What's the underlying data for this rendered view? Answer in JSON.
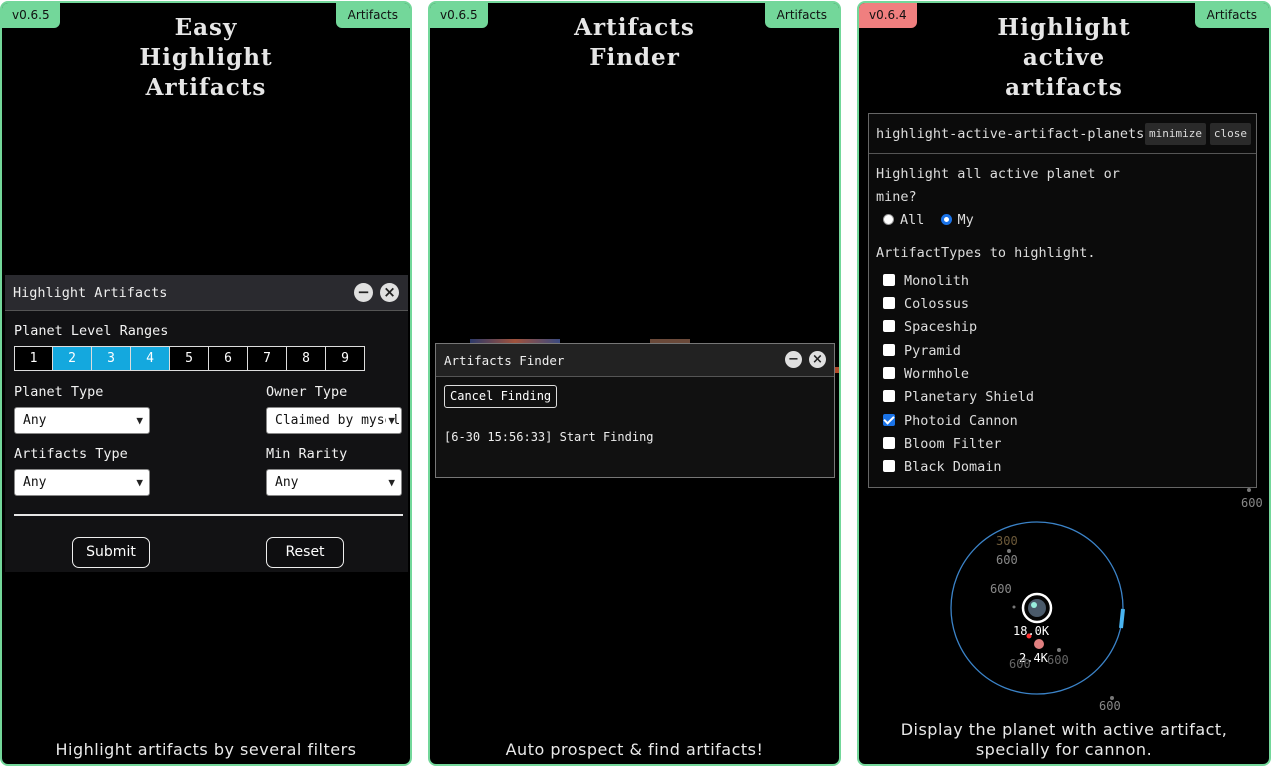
{
  "cards": [
    {
      "version": "v0.6.5",
      "tag": "Artifacts",
      "title_lines": [
        "Easy",
        "Highlight",
        "Artifacts"
      ],
      "caption": "Highlight artifacts by several filters",
      "panel": {
        "title": "Highlight Artifacts",
        "level_label": "Planet Level Ranges",
        "levels": [
          "1",
          "2",
          "3",
          "4",
          "5",
          "6",
          "7",
          "8",
          "9"
        ],
        "selected_levels": [
          "2",
          "3",
          "4"
        ],
        "planet_type_label": "Planet Type",
        "planet_type_value": "Any",
        "owner_type_label": "Owner Type",
        "owner_type_value": "Claimed by myself",
        "artifacts_type_label": "Artifacts Type",
        "artifacts_type_value": "Any",
        "min_rarity_label": "Min Rarity",
        "min_rarity_value": "Any",
        "submit_label": "Submit",
        "reset_label": "Reset"
      }
    },
    {
      "version": "v0.6.5",
      "tag": "Artifacts",
      "title_lines": [
        "Artifacts",
        "Finder"
      ],
      "caption": "Auto prospect & find artifacts!",
      "panel": {
        "title": "Artifacts Finder",
        "cancel_label": "Cancel Finding",
        "log_line": "[6-30 15:56:33] Start Finding"
      }
    },
    {
      "version": "v0.6.4",
      "tag": "Artifacts",
      "title_lines": [
        "Highlight",
        "active",
        "artifacts"
      ],
      "caption_lines": [
        "Display the planet with active artifact,",
        "specially for cannon."
      ],
      "panel": {
        "title": "highlight-active-artifact-planets",
        "minimize_label": "minimize",
        "close_label": "close",
        "question_lines": [
          "Highlight all active planet or",
          "mine?"
        ],
        "radio_all": "All",
        "radio_my": "My",
        "types_label": "ArtifactTypes to highlight.",
        "types": [
          {
            "label": "Monolith",
            "checked": false
          },
          {
            "label": "Colossus",
            "checked": false
          },
          {
            "label": "Spaceship",
            "checked": false
          },
          {
            "label": "Pyramid",
            "checked": false
          },
          {
            "label": "Wormhole",
            "checked": false
          },
          {
            "label": "Planetary Shield",
            "checked": false
          },
          {
            "label": "Photoid Cannon",
            "checked": true
          },
          {
            "label": "Bloom Filter",
            "checked": false
          },
          {
            "label": "Black Domain",
            "checked": false
          }
        ]
      },
      "map_labels": [
        "300",
        "600",
        "600",
        "18.0K",
        "2.4K",
        "600",
        "600",
        "600",
        "600"
      ]
    }
  ],
  "colors": {
    "border_green": "#73d79a",
    "old_version_red": "#f07f7f",
    "level_selected": "#14a8de",
    "radio_checkbox_blue": "#1a73e8"
  }
}
